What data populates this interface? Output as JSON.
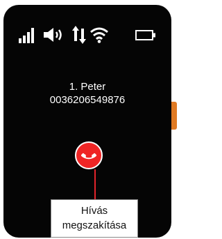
{
  "status_bar": {
    "icons": [
      "signal-icon",
      "volume-icon",
      "data-transfer-icon",
      "wifi-icon",
      "battery-icon"
    ]
  },
  "call": {
    "contact_name": "1.   Peter",
    "phone_number": "0036206549876"
  },
  "hangup": {
    "icon": "phone-hangup-icon",
    "color": "#ef2525"
  },
  "callout": {
    "line1": "Hívás",
    "line2": "megszakítása"
  },
  "colors": {
    "screen": "#050505",
    "side_button": "#e07a23",
    "callout_line": "#e3232b"
  }
}
